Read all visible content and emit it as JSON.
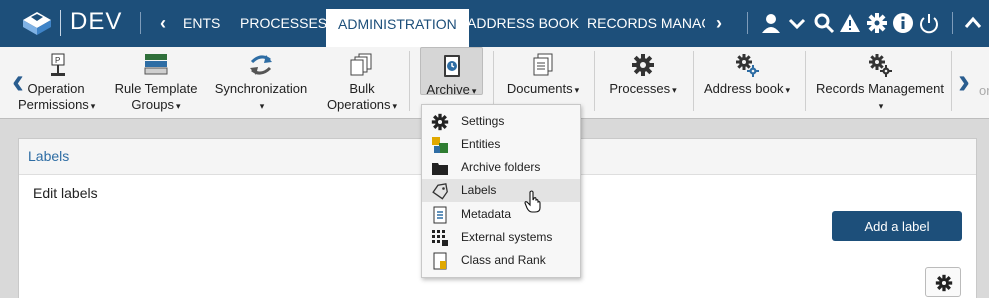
{
  "header": {
    "env_label": "DEV",
    "tabs": [
      {
        "label": "ENTS"
      },
      {
        "label": "PROCESSES"
      },
      {
        "label": "ADMINISTRATION",
        "active": true
      },
      {
        "label": "ADDRESS BOOK"
      },
      {
        "label": "RECORDS MANAGEMENT"
      }
    ],
    "icons": [
      "user-icon",
      "chevron-down-icon",
      "search-icon",
      "warning-icon",
      "gear-icon",
      "info-icon",
      "power-icon",
      "collapse-up-icon"
    ]
  },
  "ribbon": {
    "items": [
      {
        "line1": "Operation",
        "line2": "Permissions",
        "caret": "▾",
        "icon": "permission-flag-icon"
      },
      {
        "line1": "Rule Template",
        "line2": "Groups",
        "caret": "▾",
        "icon": "rule-template-icon"
      },
      {
        "line1": "Synchronization",
        "line2": "",
        "caret": "▾",
        "icon": "sync-icon"
      },
      {
        "line1": "Bulk",
        "line2": "Operations",
        "caret": "▾",
        "icon": "bulk-documents-icon"
      },
      {
        "line1": "Archive",
        "line2": "",
        "caret": "▾",
        "icon": "archive-icon"
      },
      {
        "line1": "Documents",
        "line2": "",
        "caret": "▾",
        "icon": "documents-icon"
      },
      {
        "line1": "Processes",
        "line2": "",
        "caret": "▾",
        "icon": "gear-icon"
      },
      {
        "line1": "Address book",
        "line2": "",
        "caret": "▾",
        "icon": "gears-icon"
      },
      {
        "line1": "Records Management",
        "line2": "",
        "caret": "▾",
        "icon": "gears-icon"
      }
    ],
    "partial_right": "or"
  },
  "archive_menu": {
    "items": [
      {
        "label": "Settings",
        "icon": "gear-icon"
      },
      {
        "label": "Entities",
        "icon": "entities-icon"
      },
      {
        "label": "Archive folders",
        "icon": "folder-icon"
      },
      {
        "label": "Labels",
        "icon": "tag-icon",
        "hover": true
      },
      {
        "label": "Metadata",
        "icon": "metadata-icon"
      },
      {
        "label": "External systems",
        "icon": "external-systems-icon"
      },
      {
        "label": "Class and Rank",
        "icon": "class-rank-icon"
      }
    ]
  },
  "panel": {
    "title": "Labels",
    "subtitle": "Edit labels",
    "add_button": "Add a label"
  },
  "colors": {
    "brand": "#1d4f7a",
    "link": "#2e6da4",
    "background": "#d9d9d9"
  }
}
